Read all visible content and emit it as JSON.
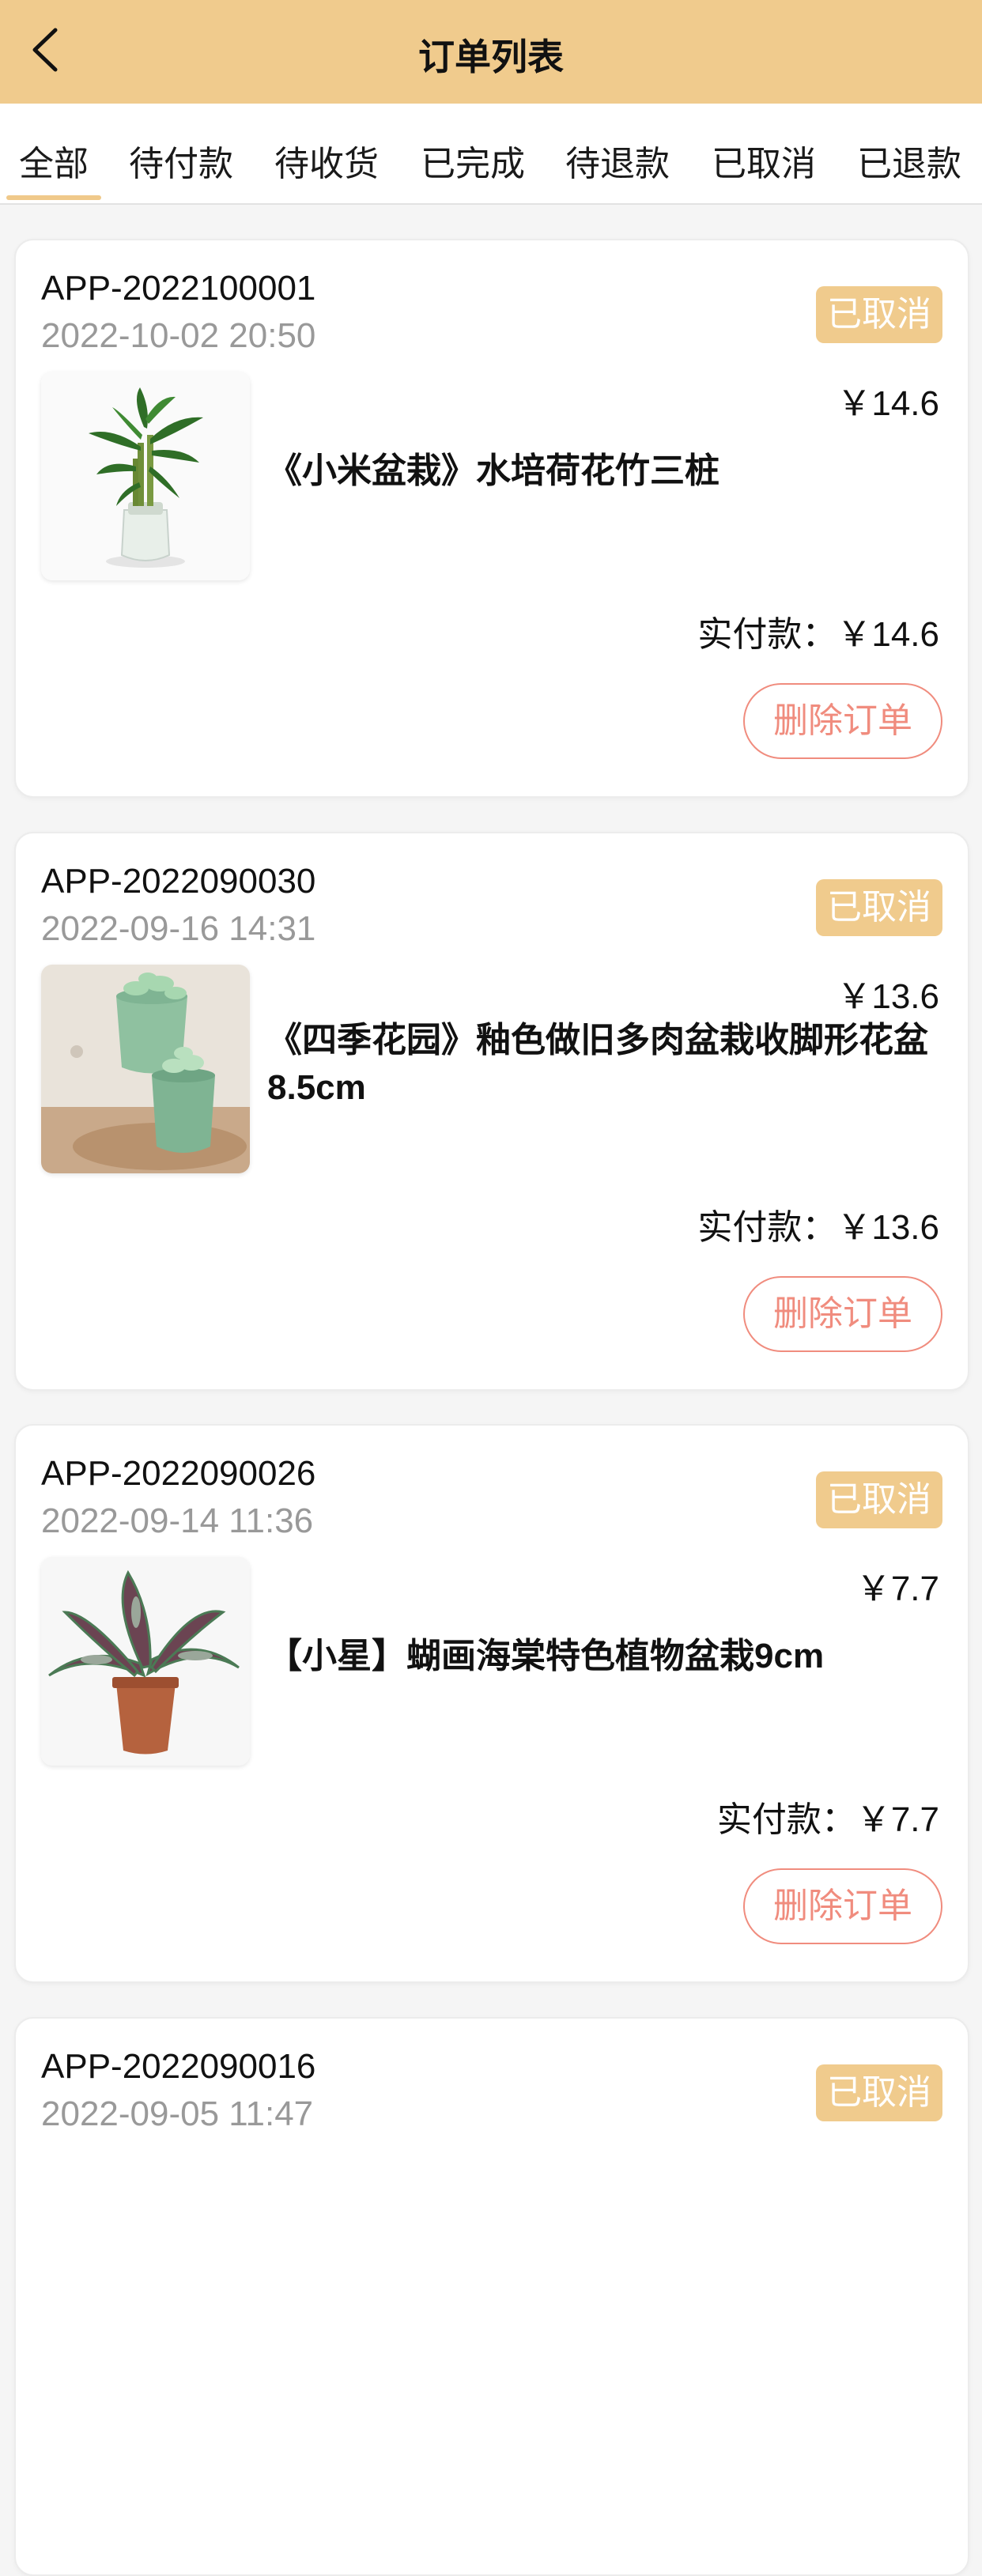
{
  "header": {
    "title": "订单列表",
    "back_icon": "chevron-left-icon"
  },
  "tabs": [
    {
      "label": "全部",
      "active": true
    },
    {
      "label": "待付款",
      "active": false
    },
    {
      "label": "待收货",
      "active": false
    },
    {
      "label": "已完成",
      "active": false
    },
    {
      "label": "待退款",
      "active": false
    },
    {
      "label": "已取消",
      "active": false
    },
    {
      "label": "已退款",
      "active": false
    }
  ],
  "orders": [
    {
      "id": "APP-2022100001",
      "time": "2022-10-02 20:50",
      "status": "已取消",
      "price": "￥14.6",
      "product": "《小米盆栽》水培荷花竹三桩",
      "paid": "实付款：￥14.6",
      "action": "删除订单"
    },
    {
      "id": "APP-2022090030",
      "time": "2022-09-16 14:31",
      "status": "已取消",
      "price": "￥13.6",
      "product": "《四季花园》釉色做旧多肉盆栽收脚形花盆8.5cm",
      "paid": "实付款：￥13.6",
      "action": "删除订单"
    },
    {
      "id": "APP-2022090026",
      "time": "2022-09-14 11:36",
      "status": "已取消",
      "price": "￥7.7",
      "product": "【小星】蝴画海棠特色植物盆栽9cm",
      "paid": "实付款：￥7.7",
      "action": "删除订单"
    },
    {
      "id": "APP-2022090016",
      "time": "2022-09-05 11:47",
      "status": "已取消"
    }
  ],
  "colors": {
    "header_bg": "#f0cb8d",
    "badge_bg": "#f0cb8d",
    "delete_accent": "#f08c7e",
    "muted_text": "#999999"
  }
}
